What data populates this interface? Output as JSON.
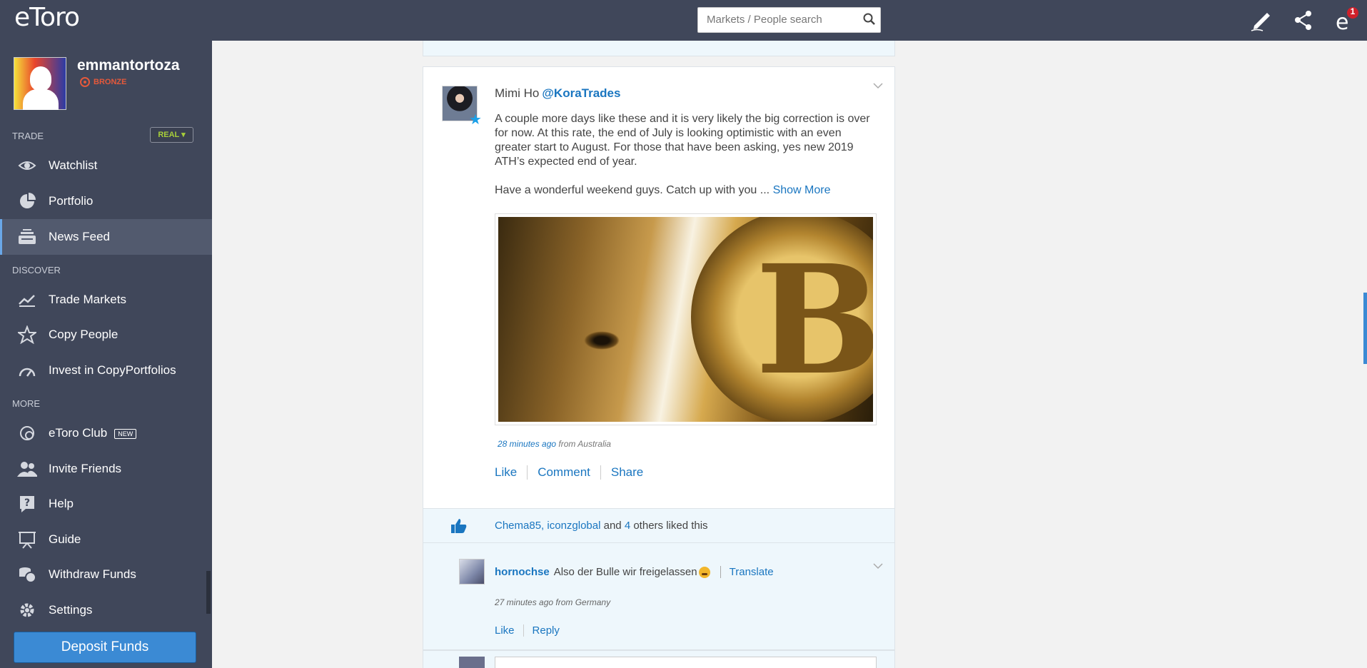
{
  "app": {
    "logo_text": "eToro"
  },
  "user": {
    "name": "emmantortoza",
    "tier": "BRONZE"
  },
  "sidebar": {
    "sections": {
      "trade": "TRADE",
      "discover": "DISCOVER",
      "more": "MORE"
    },
    "mode_button": "REAL",
    "items": [
      {
        "label": "Watchlist",
        "icon": "eye-icon"
      },
      {
        "label": "Portfolio",
        "icon": "pie-chart-icon"
      },
      {
        "label": "News Feed",
        "icon": "news-icon"
      },
      {
        "label": "Trade Markets",
        "icon": "trend-icon"
      },
      {
        "label": "Copy People",
        "icon": "star-icon"
      },
      {
        "label": "Invest in CopyPortfolios",
        "icon": "gauge-icon"
      },
      {
        "label": "eToro Club",
        "icon": "club-icon",
        "badge": "NEW"
      },
      {
        "label": "Invite Friends",
        "icon": "users-icon"
      },
      {
        "label": "Help",
        "icon": "help-icon"
      },
      {
        "label": "Guide",
        "icon": "guide-icon"
      },
      {
        "label": "Withdraw Funds",
        "icon": "coins-icon"
      },
      {
        "label": "Settings",
        "icon": "gear-icon"
      }
    ],
    "active_item": "News Feed",
    "deposit_button": "Deposit Funds"
  },
  "header": {
    "search_placeholder": "Markets / People search",
    "notification_count": "1"
  },
  "post": {
    "author_name": "Mimi Ho",
    "author_handle": "@KoraTrades",
    "paragraph1": "A couple more days like these and it is very likely the big correction is over for now. At this rate, the end of July is looking optimistic with an even greater start to August. For those that have been asking, yes new 2019 ATH’s expected end of year.",
    "paragraph2": "Have a wonderful weekend guys. Catch up with you ...",
    "show_more": "Show More",
    "time": "28 minutes ago",
    "location": "from Australia",
    "actions": {
      "like": "Like",
      "comment": "Comment",
      "share": "Share"
    },
    "likes": {
      "user1": "Chema85",
      "sep": ",",
      "user2": "iconzglobal",
      "and": "and",
      "count": "4",
      "rest": "others liked this"
    }
  },
  "comment": {
    "author": "hornochse",
    "text": "Also der Bulle wir freigelassen",
    "translate": "Translate",
    "time": "27 minutes ago from Germany",
    "actions": {
      "like": "Like",
      "reply": "Reply"
    }
  },
  "colors": {
    "sidebar_bg": "#40475a",
    "link": "#1a76c0",
    "deposit": "#3b8ad4",
    "tier": "#e5593b",
    "real": "#a7ce3a"
  }
}
